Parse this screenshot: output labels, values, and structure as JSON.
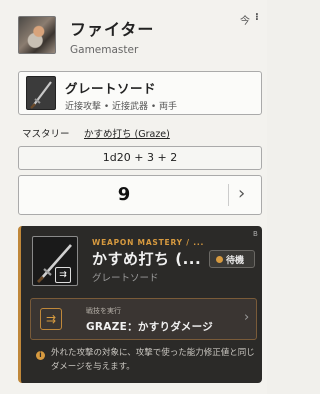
{
  "header": {
    "title": "ファイター",
    "subtitle": "Gamemaster",
    "icon_a": "今",
    "icon_b": "⁝"
  },
  "weapon": {
    "name": "グレートソード",
    "tags": "近接攻撃 • 近接武器 • 両手",
    "icon": "greatsword-icon"
  },
  "mastery_row": {
    "label": "マスタリー",
    "value": "かすめ打ち (Graze)"
  },
  "roll": {
    "formula": "1d20 + 3 + 2",
    "result": "9",
    "chevron": "›"
  },
  "mastery_card": {
    "corner": "B",
    "kicker": "WEAPON MASTERY / ...",
    "title": "かすめ打ち (...",
    "subtitle": "グレートソード",
    "status": "待機",
    "badge": "⇉",
    "action": {
      "icon": "⇉",
      "caption": "戦技を実行",
      "label": "GRAZE：かすりダメージ",
      "chevron": "›"
    },
    "info_icon": "i",
    "info": "外れた攻撃の対象に、攻撃で使った能力修正値と同じダメージを与えます。"
  },
  "colors": {
    "accent": "#d79a3f",
    "card_dark": "#2b2a28",
    "panel": "#f3f2ee"
  }
}
